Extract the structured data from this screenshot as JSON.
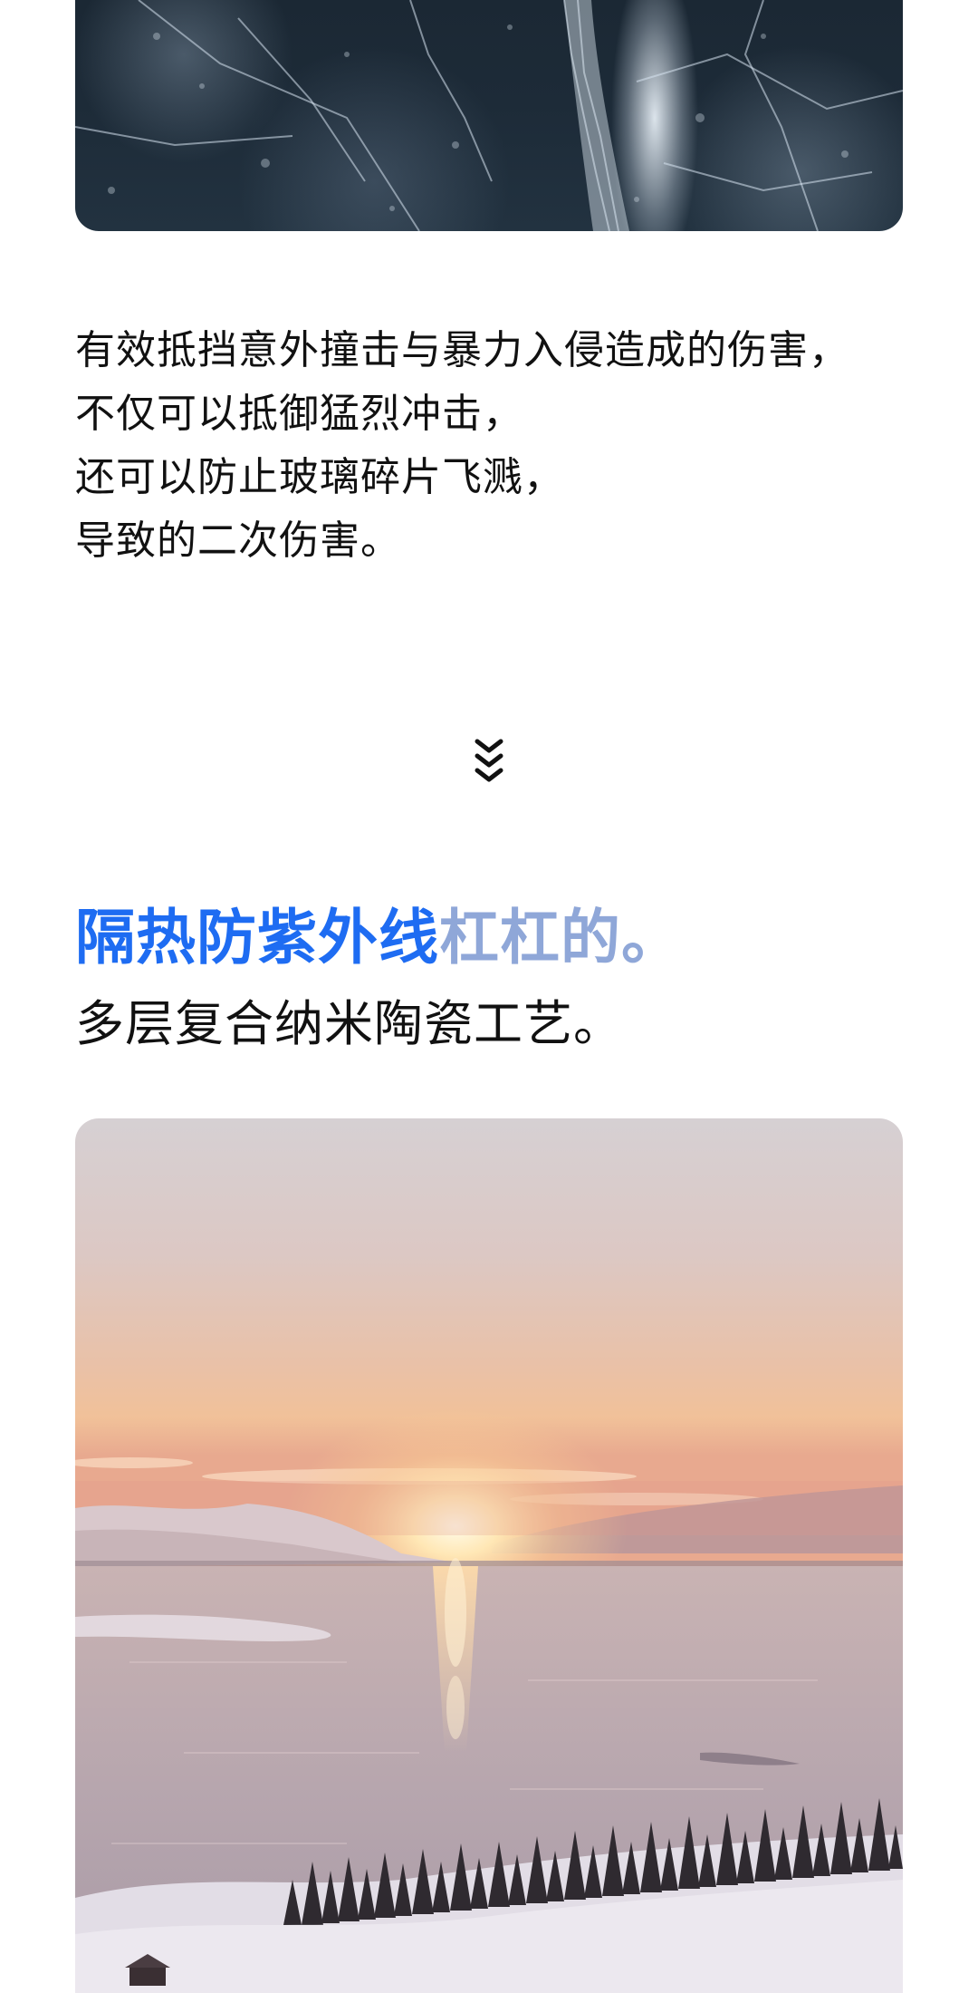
{
  "images": {
    "top_icon": "cracked-ice-photo",
    "bottom_icon": "lake-sunset-photo"
  },
  "description": {
    "lines": [
      "有效抵挡意外撞击与暴力入侵造成的伤害，",
      "不仅可以抵御猛烈冲击，",
      "还可以防止玻璃碎片飞溅，",
      "导致的二次伤害。"
    ]
  },
  "scroll_hint": {
    "icon": "double-chevron-down-icon"
  },
  "headline": {
    "highlight": "隔热防紫外线",
    "suffix": "杠杠的。"
  },
  "subheadline": "多层复合纳米陶瓷工艺。",
  "colors": {
    "accent": "#1e6cf2",
    "accent_light": "#8fa7d8",
    "text": "#111111"
  }
}
